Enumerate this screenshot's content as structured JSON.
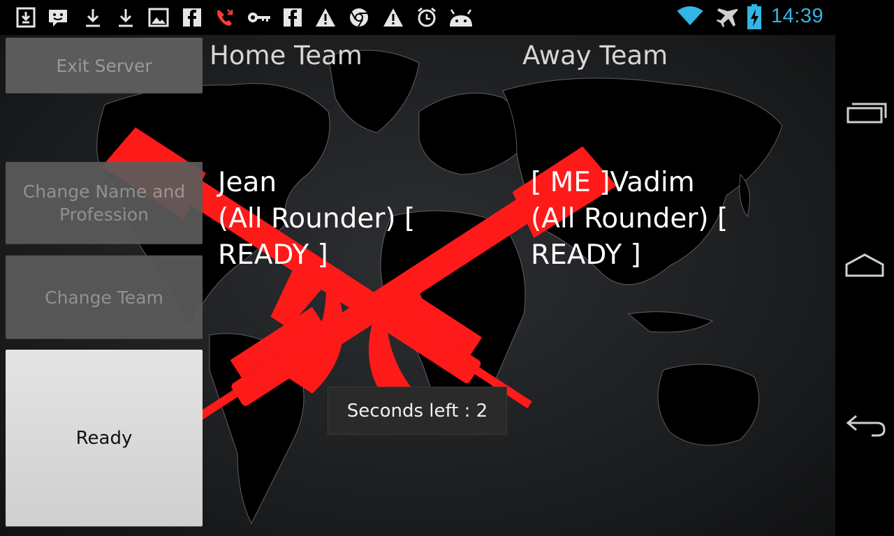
{
  "status_bar": {
    "time": "14:39",
    "notification_icons": [
      "download-box-icon",
      "chat-icon",
      "download-icon",
      "download-icon",
      "image-icon",
      "facebook-icon",
      "missed-call-icon",
      "key-icon",
      "facebook-icon",
      "warning-icon",
      "chrome-icon",
      "warning-icon",
      "alarm-icon",
      "android-icon"
    ],
    "system_icons": [
      "wifi-icon",
      "airplane-icon",
      "battery-charging-icon"
    ],
    "accent_color": "#33b5e5"
  },
  "sidebar": {
    "exit_label": "Exit Server",
    "change_name_label": "Change Name and\nProfession",
    "change_team_label": "Change Team",
    "ready_label": "Ready"
  },
  "teams": {
    "home": {
      "title": "Home Team",
      "players": [
        "Jean",
        "(All Rounder) [",
        "READY ]"
      ]
    },
    "away": {
      "title": "Away Team",
      "players": [
        "[ ME ]Vadim",
        "(All Rounder) [",
        "READY ]"
      ]
    }
  },
  "toast": {
    "text": "Seconds left : 2"
  },
  "navigation": [
    "recent-apps-icon",
    "home-icon",
    "back-icon"
  ],
  "emblem_color": "#ff1a1a"
}
